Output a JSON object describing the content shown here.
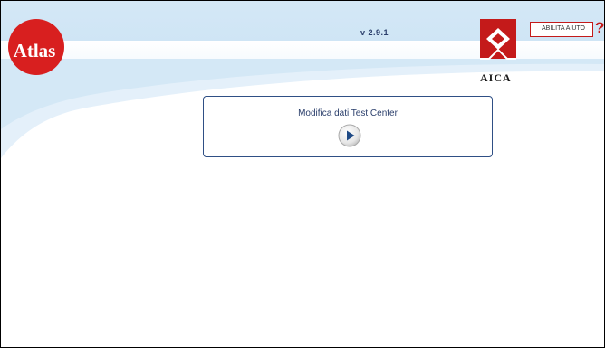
{
  "header": {
    "version": "v 2.9.1",
    "atlas_logo_text": "Atlas",
    "aica_logo_text": "AICA",
    "help_toggle_label": "ABILITA AIUTO",
    "help_icon_glyph": "?"
  },
  "main": {
    "card": {
      "title": "Modifica dati Test Center",
      "action_icon": "play-icon"
    }
  },
  "colors": {
    "header_blue": "#cfe5f5",
    "brand_red": "#c41a1a",
    "text_navy": "#2a3e6b",
    "card_border": "#2f4f85"
  }
}
